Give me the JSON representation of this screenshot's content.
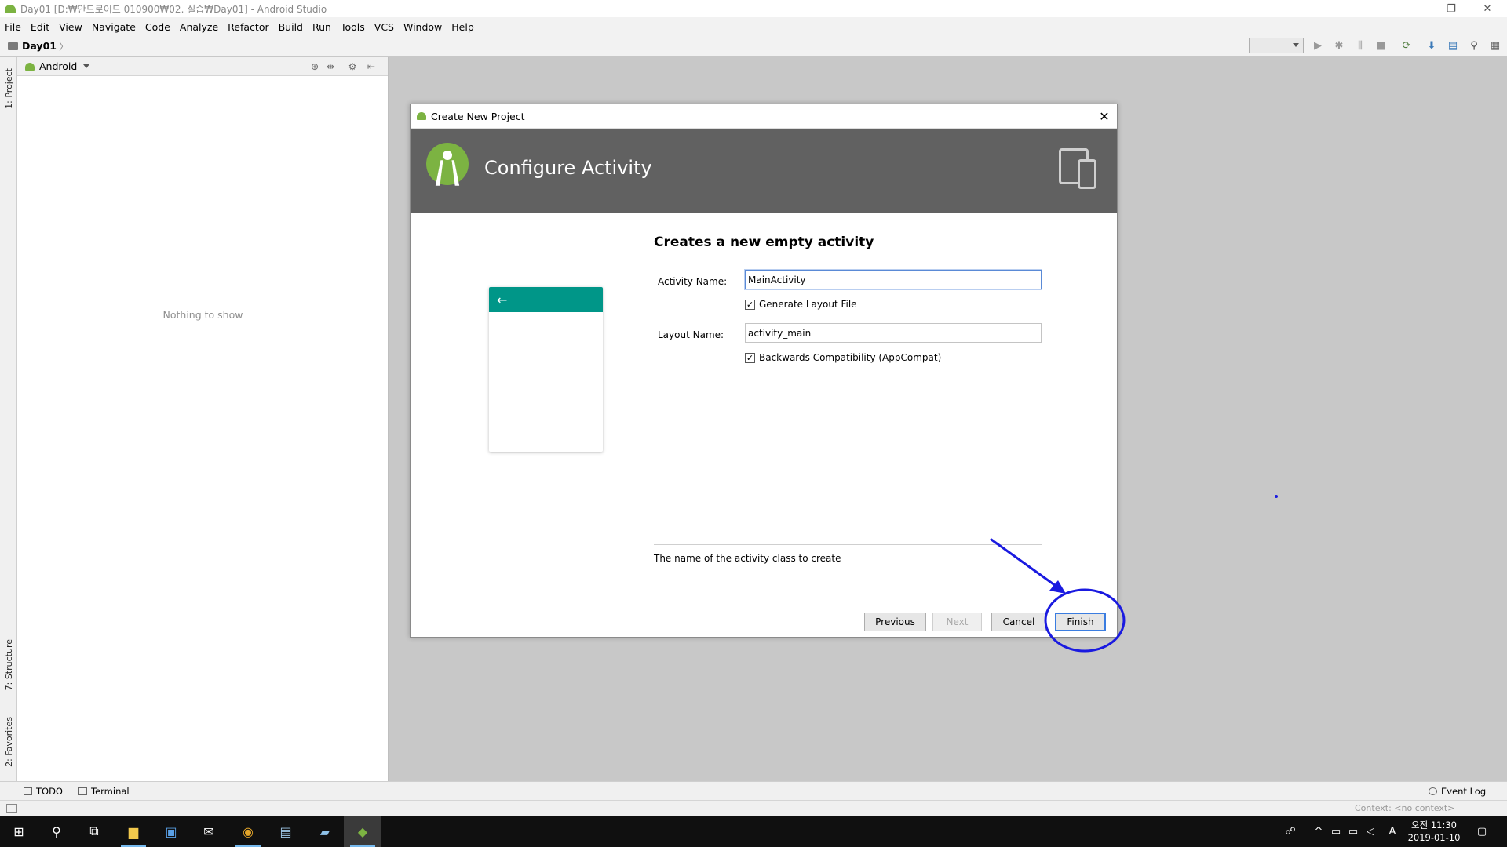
{
  "window": {
    "title": "Day01 [D:₩안드로이드 010900₩02. 실습₩Day01] - Android Studio",
    "minimize_glyph": "—",
    "restore_glyph": "❐",
    "close_glyph": "✕"
  },
  "menu": [
    "File",
    "Edit",
    "View",
    "Navigate",
    "Code",
    "Analyze",
    "Refactor",
    "Build",
    "Run",
    "Tools",
    "VCS",
    "Window",
    "Help"
  ],
  "nav": {
    "breadcrumb": "Day01",
    "separator": "〉"
  },
  "toolbar": {
    "icons": [
      "run-icon",
      "debug-icon",
      "profile-icon",
      "stop-icon",
      "sync-icon",
      "sdk-manager-icon",
      "project-structure-icon",
      "search-icon",
      "device-manager-icon"
    ],
    "glyphs": [
      "▶",
      "✱",
      "⫼",
      "■",
      "⟳",
      "⬇",
      "▤",
      "⚲",
      "▦"
    ]
  },
  "left_tabs": {
    "project": "1: Project",
    "structure": "7: Structure",
    "favorites": "2: Favorites"
  },
  "project_panel": {
    "view_label": "Android",
    "empty_text": "Nothing to show",
    "icon_glyphs": {
      "locate": "⊕",
      "collapse": "⇼",
      "settings": "⚙",
      "hide": "⇤"
    }
  },
  "dialog": {
    "window_title": "Create New Project",
    "close_glyph": "✕",
    "banner_title": "Configure Activity",
    "form_title": "Creates a new empty activity",
    "activity_name_label": "Activity Name:",
    "activity_name_value": "MainActivity",
    "generate_layout_label": "Generate Layout File",
    "generate_layout_checked": true,
    "layout_name_label": "Layout Name:",
    "layout_name_value": "activity_main",
    "backwards_compat_label": "Backwards Compatibility (AppCompat)",
    "backwards_compat_checked": true,
    "check_glyph": "✓",
    "back_arrow": "←",
    "hint": "The name of the activity class to create",
    "buttons": {
      "previous": "Previous",
      "next": "Next",
      "cancel": "Cancel",
      "finish": "Finish"
    }
  },
  "bottom_tools": {
    "todo": "TODO",
    "terminal": "Terminal",
    "event_log": "Event Log"
  },
  "status": {
    "context": "Context: <no context>"
  },
  "taskbar": {
    "clock_time": "오전 11:30",
    "clock_date": "2019-01-10",
    "ime": "A",
    "glyphs": {
      "start": "⊞",
      "search": "⚲",
      "task_view": "⧉",
      "explorer": "▆",
      "store": "▣",
      "mail": "✉",
      "chrome": "◉",
      "photos": "▤",
      "notes": "▰",
      "android": "◆",
      "people": "☍",
      "chevron": "^",
      "network": "▭",
      "speaker": "◁",
      "notification": "▢"
    }
  },
  "colors": {
    "accent_teal": "#009688",
    "android_green": "#7cb342",
    "banner_gray": "#616161",
    "annotation_blue": "#1a1ae0"
  }
}
